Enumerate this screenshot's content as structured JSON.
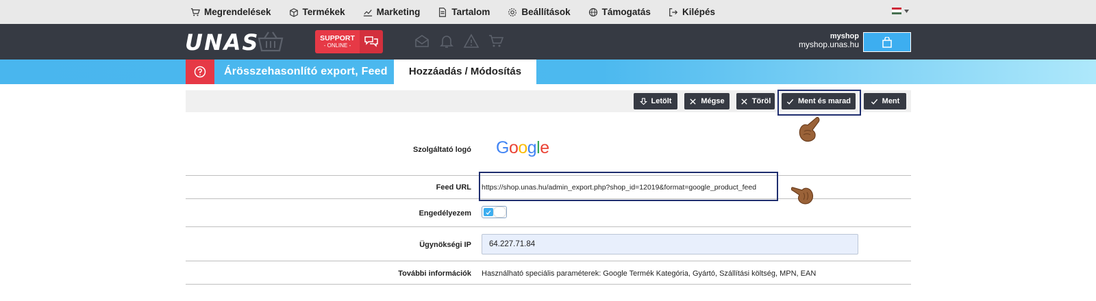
{
  "topnav": {
    "items": [
      {
        "label": "Megrendelések",
        "icon": "cart-icon"
      },
      {
        "label": "Termékek",
        "icon": "box-icon"
      },
      {
        "label": "Marketing",
        "icon": "chart-icon"
      },
      {
        "label": "Tartalom",
        "icon": "document-icon"
      },
      {
        "label": "Beállítások",
        "icon": "gear-icon"
      },
      {
        "label": "Támogatás",
        "icon": "globe-icon"
      },
      {
        "label": "Kilépés",
        "icon": "logout-icon"
      }
    ],
    "language_flag_colors": [
      "#ce2939",
      "#ffffff",
      "#477050"
    ]
  },
  "header": {
    "logo": "UNAS",
    "support_line1": "SUPPORT",
    "support_line2": "- ONLINE -",
    "shop_name": "myshop",
    "shop_url": "myshop.unas.hu"
  },
  "breadcrumb": {
    "section": "Árösszehasonlító export, Feed",
    "current": "Hozzáadás / Módosítás"
  },
  "toolbar": {
    "download": "Letölt",
    "cancel": "Mégse",
    "delete": "Töröl",
    "save_stay": "Ment és marad",
    "save": "Ment"
  },
  "form": {
    "provider_logo_label": "Szolgáltató logó",
    "provider_logo_text": "Google",
    "feed_url_label": "Feed URL",
    "feed_url_value": "https://shop.unas.hu/admin_export.php?shop_id=12019&format=google_product_feed",
    "enable_label": "Engedélyezem",
    "enabled": true,
    "agency_ip_label": "Ügynökségi IP",
    "agency_ip_value": "64.227.71.84",
    "more_info_label": "További információk",
    "more_info_value": "Használható speciális paraméterek: Google Termék Kategória, Gyártó, Szállítási költség, MPN, EAN"
  },
  "colors": {
    "accent_blue": "#3daef0",
    "header_dark": "#363a43",
    "support_red": "#e63946",
    "highlight_navy": "#1e2d6e"
  }
}
